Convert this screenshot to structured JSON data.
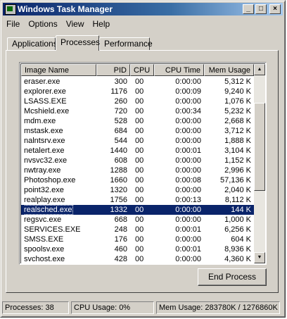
{
  "window": {
    "title": "Windows Task Manager",
    "buttons": {
      "minimize": "_",
      "maximize": "□",
      "close": "×"
    }
  },
  "menu": [
    "File",
    "Options",
    "View",
    "Help"
  ],
  "tabs": [
    {
      "label": "Applications",
      "active": false
    },
    {
      "label": "Processes",
      "active": true
    },
    {
      "label": "Performance",
      "active": false
    }
  ],
  "processes": {
    "columns": [
      "Image Name",
      "PID",
      "CPU",
      "CPU Time",
      "Mem Usage"
    ],
    "rows": [
      {
        "name": "eraser.exe",
        "pid": "300",
        "cpu": "00",
        "cpu_time": "0:00:00",
        "mem": "5,312 K"
      },
      {
        "name": "explorer.exe",
        "pid": "1176",
        "cpu": "00",
        "cpu_time": "0:00:09",
        "mem": "9,240 K"
      },
      {
        "name": "LSASS.EXE",
        "pid": "260",
        "cpu": "00",
        "cpu_time": "0:00:00",
        "mem": "1,076 K"
      },
      {
        "name": "Mcshield.exe",
        "pid": "720",
        "cpu": "00",
        "cpu_time": "0:00:34",
        "mem": "5,232 K"
      },
      {
        "name": "mdm.exe",
        "pid": "528",
        "cpu": "00",
        "cpu_time": "0:00:00",
        "mem": "2,668 K"
      },
      {
        "name": "mstask.exe",
        "pid": "684",
        "cpu": "00",
        "cpu_time": "0:00:00",
        "mem": "3,712 K"
      },
      {
        "name": "nalntsrv.exe",
        "pid": "544",
        "cpu": "00",
        "cpu_time": "0:00:00",
        "mem": "1,888 K"
      },
      {
        "name": "netalert.exe",
        "pid": "1440",
        "cpu": "00",
        "cpu_time": "0:00:01",
        "mem": "3,104 K"
      },
      {
        "name": "nvsvc32.exe",
        "pid": "608",
        "cpu": "00",
        "cpu_time": "0:00:00",
        "mem": "1,152 K"
      },
      {
        "name": "nwtray.exe",
        "pid": "1288",
        "cpu": "00",
        "cpu_time": "0:00:00",
        "mem": "2,996 K"
      },
      {
        "name": "Photoshop.exe",
        "pid": "1660",
        "cpu": "00",
        "cpu_time": "0:00:08",
        "mem": "57,136 K"
      },
      {
        "name": "point32.exe",
        "pid": "1320",
        "cpu": "00",
        "cpu_time": "0:00:00",
        "mem": "2,040 K"
      },
      {
        "name": "realplay.exe",
        "pid": "1756",
        "cpu": "00",
        "cpu_time": "0:00:13",
        "mem": "8,112 K"
      },
      {
        "name": "realsched.exe",
        "pid": "1332",
        "cpu": "00",
        "cpu_time": "0:00:00",
        "mem": "144 K",
        "selected": true
      },
      {
        "name": "regsvc.exe",
        "pid": "668",
        "cpu": "00",
        "cpu_time": "0:00:00",
        "mem": "1,000 K"
      },
      {
        "name": "SERVICES.EXE",
        "pid": "248",
        "cpu": "00",
        "cpu_time": "0:00:01",
        "mem": "6,256 K"
      },
      {
        "name": "SMSS.EXE",
        "pid": "176",
        "cpu": "00",
        "cpu_time": "0:00:00",
        "mem": "604 K"
      },
      {
        "name": "spoolsv.exe",
        "pid": "460",
        "cpu": "00",
        "cpu_time": "0:00:01",
        "mem": "8,936 K"
      },
      {
        "name": "svchost.exe",
        "pid": "428",
        "cpu": "00",
        "cpu_time": "0:00:00",
        "mem": "4,360 K"
      }
    ]
  },
  "scrollbar": {
    "up_glyph": "▲",
    "down_glyph": "▼"
  },
  "end_process_label": "End Process",
  "statusbar": {
    "processes": "Processes: 38",
    "cpu": "CPU Usage: 0%",
    "mem": "Mem Usage: 283780K / 1276860K"
  },
  "colors": {
    "selection": "#0a246a",
    "title_gradient_start": "#0a246a",
    "title_gradient_end": "#a6caf0"
  }
}
